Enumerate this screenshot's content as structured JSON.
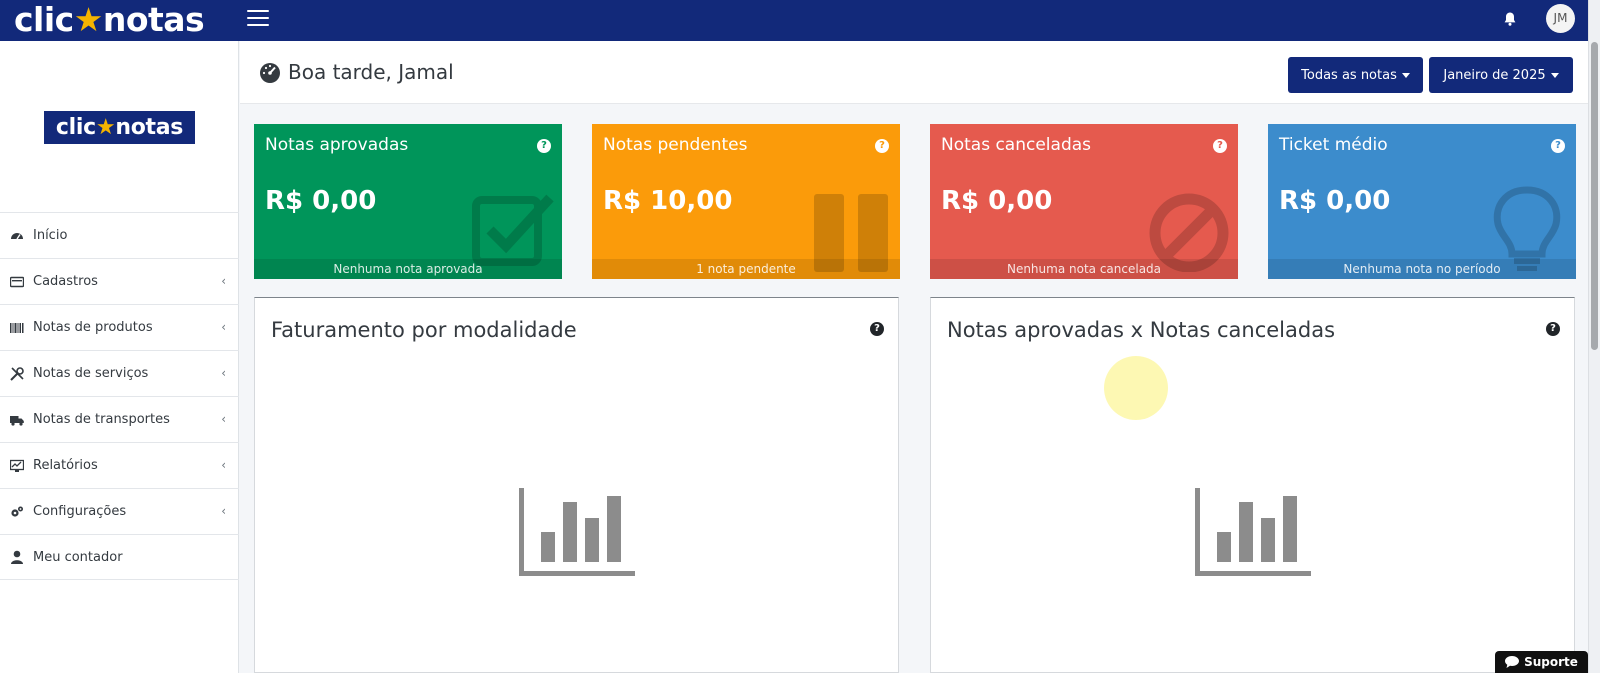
{
  "brand": {
    "logo_text_a": "clic",
    "logo_text_b": "notas"
  },
  "header": {
    "avatar_initials": "JM"
  },
  "sidebar": {
    "items": [
      {
        "label": "Início",
        "icon": "dashboard-icon",
        "has_submenu": false
      },
      {
        "label": "Cadastros",
        "icon": "id-card-icon",
        "has_submenu": true
      },
      {
        "label": "Notas de produtos",
        "icon": "barcode-icon",
        "has_submenu": true
      },
      {
        "label": "Notas de serviços",
        "icon": "tools-icon",
        "has_submenu": true
      },
      {
        "label": "Notas de transportes",
        "icon": "truck-icon",
        "has_submenu": true
      },
      {
        "label": "Relatórios",
        "icon": "chart-report-icon",
        "has_submenu": true
      },
      {
        "label": "Configurações",
        "icon": "cogs-icon",
        "has_submenu": true
      },
      {
        "label": "Meu contador",
        "icon": "user-icon",
        "has_submenu": false
      }
    ]
  },
  "page": {
    "greeting": "Boa tarde, Jamal",
    "filter_notes": "Todas as notas",
    "filter_month": "Janeiro de 2025"
  },
  "cards": [
    {
      "title": "Notas aprovadas",
      "value": "R$ 0,00",
      "footer": "Nenhuma nota aprovada",
      "color": "#00955a",
      "icon": "check-square-icon"
    },
    {
      "title": "Notas pendentes",
      "value": "R$ 10,00",
      "footer": "1 nota pendente",
      "color": "#fb9b0a",
      "icon": "pause-icon"
    },
    {
      "title": "Notas canceladas",
      "value": "R$ 0,00",
      "footer": "Nenhuma nota cancelada",
      "color": "#e55a4e",
      "icon": "ban-icon"
    },
    {
      "title": "Ticket médio",
      "value": "R$ 0,00",
      "footer": "Nenhuma nota no período",
      "color": "#3c8ccc",
      "icon": "lightbulb-icon"
    }
  ],
  "panels": [
    {
      "title": "Faturamento por modalidade",
      "icon": "bar-chart-empty-icon"
    },
    {
      "title": "Notas aprovadas x Notas canceladas",
      "icon": "bar-chart-empty-icon"
    }
  ],
  "support": {
    "label": "Suporte"
  },
  "help_glyph": "?"
}
